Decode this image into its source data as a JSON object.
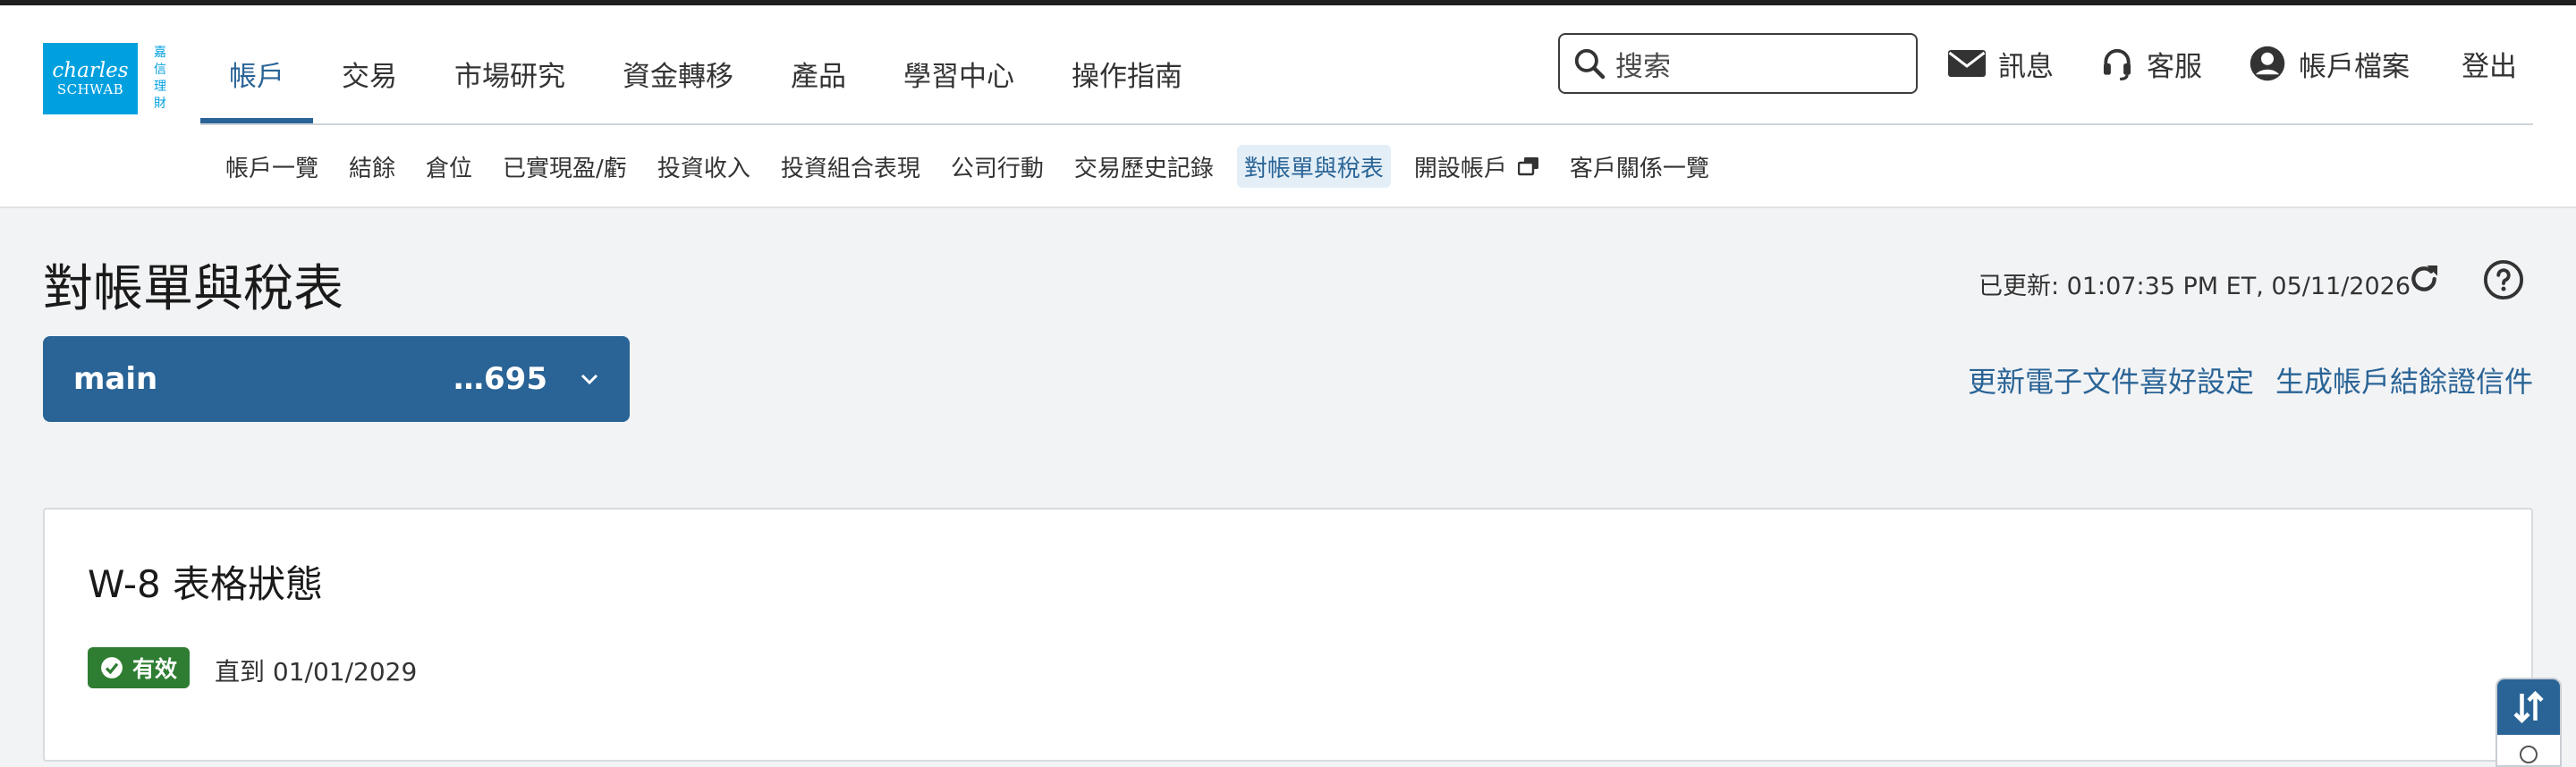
{
  "logo": {
    "line1": "charles",
    "line2": "SCHWAB",
    "cn": [
      "嘉",
      "信",
      "理",
      "財"
    ]
  },
  "main_nav": [
    {
      "label": "帳戶",
      "active": true
    },
    {
      "label": "交易"
    },
    {
      "label": "市場研究"
    },
    {
      "label": "資金轉移"
    },
    {
      "label": "產品"
    },
    {
      "label": "學習中心"
    },
    {
      "label": "操作指南"
    }
  ],
  "search": {
    "placeholder": "搜索"
  },
  "utility": {
    "messages": "訊息",
    "support": "客服",
    "profile": "帳戶檔案",
    "logout": "登出"
  },
  "sub_nav": [
    {
      "label": "帳戶一覽"
    },
    {
      "label": "結餘"
    },
    {
      "label": "倉位"
    },
    {
      "label": "已實現盈/虧"
    },
    {
      "label": "投資收入"
    },
    {
      "label": "投資組合表現"
    },
    {
      "label": "公司行動"
    },
    {
      "label": "交易歷史記錄"
    },
    {
      "label": "對帳單與稅表",
      "active": true
    },
    {
      "label": "開設帳戶",
      "external_icon": "external-window-icon"
    },
    {
      "label": "客戶關係一覽"
    }
  ],
  "page": {
    "title": "對帳單與稅表",
    "updated": "已更新: 01:07:35 PM ET, 05/11/2026"
  },
  "account_selector": {
    "name": "main",
    "number": "…695"
  },
  "links": {
    "edelivery": "更新電子文件喜好設定",
    "balance_letter": "生成帳戶結餘證信件"
  },
  "w8_card": {
    "title": "W-8 表格狀態",
    "badge": "有效",
    "until": "直到 01/01/2029"
  },
  "colors": {
    "brand": "#2a6496",
    "logo": "#00a0df",
    "success": "#2e7d32"
  }
}
